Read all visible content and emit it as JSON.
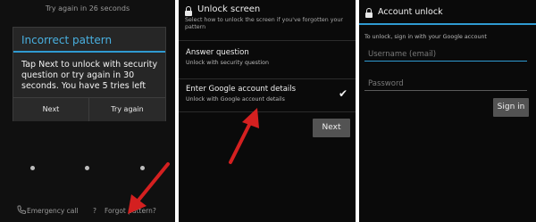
{
  "lock_screen": {
    "countdown": "Try again in 26 seconds",
    "dialog": {
      "title": "Incorrect pattern",
      "message": "Tap Next to unlock with security question or try again in 30 seconds. You have 5 tries left",
      "next_label": "Next",
      "try_again_label": "Try again"
    },
    "emergency_call": "Emergency call",
    "forgot_pattern": "Forgot pattern?"
  },
  "unlock_screen": {
    "title": "Unlock screen",
    "subtitle": "Select how to unlock the screen if you've forgotten your pattern",
    "options": [
      {
        "title": "Answer question",
        "description": "Unlock with security question"
      },
      {
        "title": "Enter Google account details",
        "description": "Unlock with Google account details"
      }
    ],
    "next_label": "Next"
  },
  "account_unlock": {
    "title": "Account unlock",
    "subtitle": "To unlock, sign in with your Google account",
    "email_placeholder": "Username (email)",
    "password_placeholder": "Password",
    "sign_in_label": "Sign in"
  },
  "colors": {
    "accent": "#2f9ad1",
    "annotation_arrow": "#d42020"
  }
}
